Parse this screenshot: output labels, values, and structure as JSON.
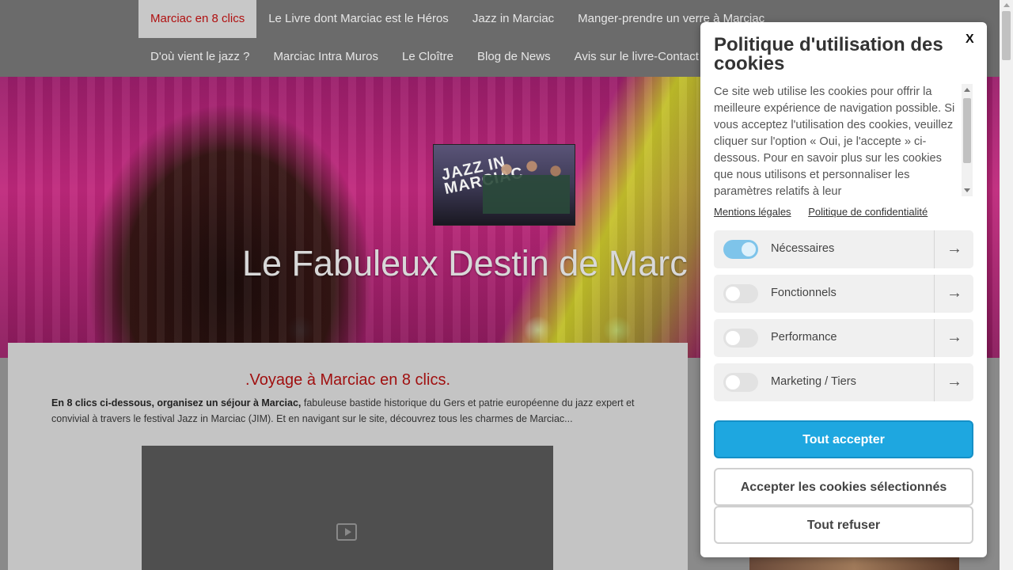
{
  "nav": {
    "row1": [
      {
        "label": "Marciac en 8 clics",
        "active": true
      },
      {
        "label": "Le Livre dont Marciac est le Héros"
      },
      {
        "label": "Jazz in Marciac"
      },
      {
        "label": "Manger-prendre un verre à Marciac"
      }
    ],
    "row2": [
      {
        "label": "D'où vient le jazz ?"
      },
      {
        "label": "Marciac Intra Muros"
      },
      {
        "label": "Le Cloître"
      },
      {
        "label": "Blog de News"
      },
      {
        "label": "Avis sur le livre-Contact"
      }
    ]
  },
  "hero": {
    "logo_text": "JAZZ IN MARCIAC",
    "title": "Le Fabuleux Destin de Marc"
  },
  "main": {
    "title": ".Voyage à Marciac en 8 clics.",
    "intro_bold": "En 8 clics ci-dessous, organisez un séjour à Marciac,",
    "intro_rest": " fabuleuse bastide historique du Gers et patrie européenne du jazz expert et convivial à travers le festival Jazz in Marciac (JIM). Et en navigant sur le site, découvrez tous les charmes de Marciac..."
  },
  "cookie": {
    "title": "Politique d'utilisation des cookies",
    "close": "X",
    "description": "Ce site web utilise les cookies pour offrir la meilleure expérience de navigation possible. Si vous acceptez l'utilisation des cookies, veuillez cliquer sur l'option « Oui, je l'accepte » ci-dessous. Pour en savoir plus sur les cookies que nous utilisons et personnaliser les paramètres relatifs à leur",
    "links": {
      "legal": "Mentions légales",
      "privacy": "Politique de confidentialité"
    },
    "categories": [
      {
        "label": "Nécessaires",
        "enabled": true
      },
      {
        "label": "Fonctionnels",
        "enabled": false
      },
      {
        "label": "Performance",
        "enabled": false
      },
      {
        "label": "Marketing / Tiers",
        "enabled": false
      }
    ],
    "arrow": "→",
    "buttons": {
      "accept_all": "Tout accepter",
      "accept_selected": "Accepter les cookies sélectionnés",
      "refuse_all": "Tout refuser"
    }
  },
  "colors": {
    "accent": "#1ea7e0",
    "nav_active_text": "#b01010",
    "title_red": "#a01010"
  }
}
